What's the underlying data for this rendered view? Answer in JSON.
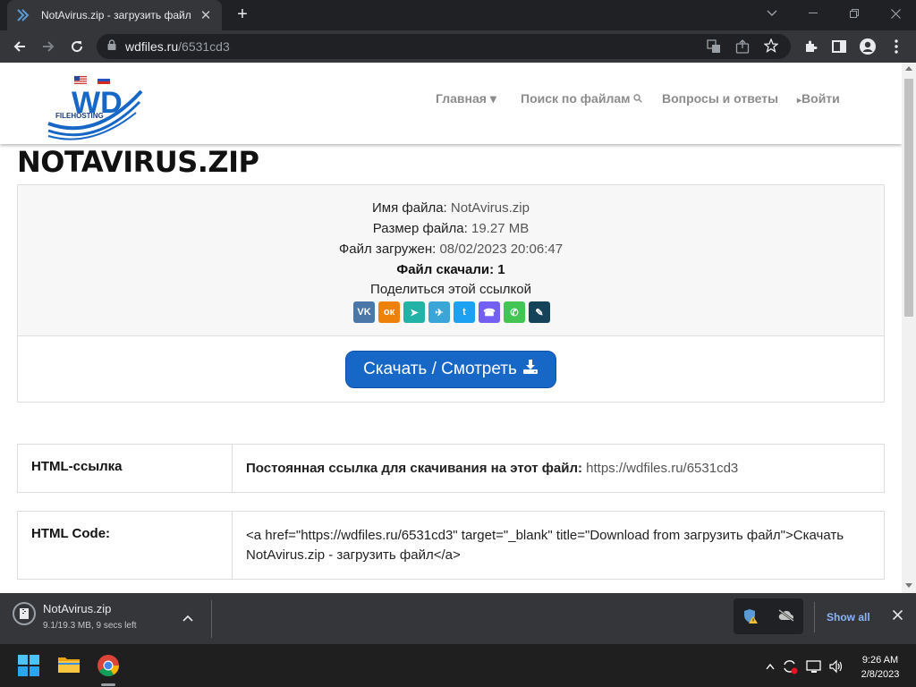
{
  "browser": {
    "tab_title": "NotAvirus.zip - загрузить файл",
    "url_host": "wdfiles.ru",
    "url_path": "/6531cd3"
  },
  "site": {
    "logo_text": "WD",
    "logo_sub": "FILEHOSTING",
    "nav": {
      "home": "Главная",
      "search": "Поиск по файлам",
      "faq": "Вопросы и ответы",
      "login": "Войти"
    }
  },
  "file": {
    "title": "NOTAVIRUS.ZIP",
    "name_label": "Имя файла:",
    "name_value": "NotAvirus.zip",
    "size_label": "Размер файла:",
    "size_value": "19.27 MB",
    "uploaded_label": "Файл загружен:",
    "uploaded_value": "08/02/2023 20:06:47",
    "downloads": "Файл скачали: 1",
    "share_label": "Поделиться этой ссылкой",
    "share_buttons": [
      {
        "name": "vk",
        "glyph": "VK",
        "color": "#4a76a8"
      },
      {
        "name": "odnoklassniki",
        "glyph": "ок",
        "color": "#ee8208"
      },
      {
        "name": "yandex-messenger",
        "glyph": "➤",
        "color": "#23b3a6"
      },
      {
        "name": "telegram",
        "glyph": "✈",
        "color": "#3aa6d8"
      },
      {
        "name": "twitter",
        "glyph": "t",
        "color": "#1da1f2"
      },
      {
        "name": "viber",
        "glyph": "☎",
        "color": "#7360f2"
      },
      {
        "name": "whatsapp",
        "glyph": "✆",
        "color": "#43c553"
      },
      {
        "name": "livejournal",
        "glyph": "✎",
        "color": "#15445a"
      }
    ],
    "download_button": "Скачать / Смотреть"
  },
  "rows": {
    "html_link_label": "HTML-ссылка",
    "html_link_text": "Постоянная ссылка для скачивания на этот файл:",
    "html_link_url": "https://wdfiles.ru/6531cd3",
    "html_code_label": "HTML Code:",
    "html_code_value": "<a href=\"https://wdfiles.ru/6531cd3\" target=\"_blank\" title=\"Download from загрузить файл\">Скачать NotAvirus.zip - загрузить файл</a>"
  },
  "download_bar": {
    "file_name": "NotAvirus.zip",
    "status": "9.1/19.3 MB, 9 secs left",
    "show_all": "Show all"
  },
  "taskbar": {
    "time": "9:26 AM",
    "date": "2/8/2023"
  }
}
